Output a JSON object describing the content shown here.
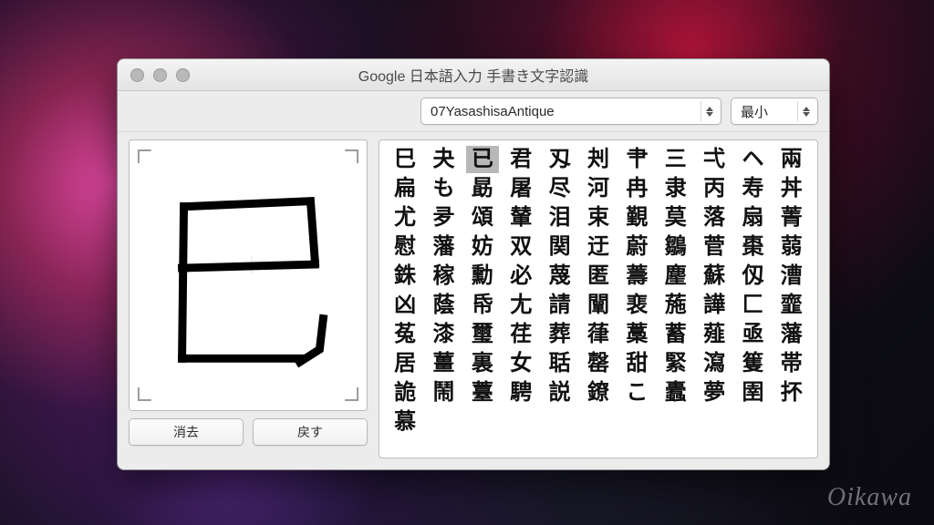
{
  "window": {
    "title": "Google 日本語入力 手書き文字認識"
  },
  "toolbar": {
    "font_select": "07YasashisaAntique",
    "size_select": "最小"
  },
  "buttons": {
    "clear_label": "消去",
    "undo_label": "戻す"
  },
  "watermark": "Oikawa",
  "selected_index": 2,
  "candidates": [
    "巳",
    "夬",
    "已",
    "君",
    "刄",
    "刔",
    "肀",
    "三",
    "弌",
    "ヘ",
    "兩",
    "扁",
    "も",
    "勗",
    "屠",
    "尽",
    "河",
    "冉",
    "隶",
    "丙",
    "寿",
    "丼",
    "尤",
    "夛",
    "頌",
    "輦",
    "泪",
    "束",
    "覲",
    "莫",
    "落",
    "扇",
    "菁",
    "慰",
    "藩",
    "妨",
    "双",
    "関",
    "迂",
    "蔚",
    "鶵",
    "菅",
    "棗",
    "蒻",
    "銖",
    "稼",
    "勳",
    "必",
    "蔑",
    "匿",
    "薵",
    "麈",
    "蘇",
    "仭",
    "漕",
    "凶",
    "蔭",
    "帋",
    "尢",
    "請",
    "闡",
    "裵",
    "葹",
    "譁",
    "匚",
    "韲",
    "菟",
    "漆",
    "璽",
    "荏",
    "葬",
    "葎",
    "藁",
    "蓄",
    "薤",
    "亟",
    "藩",
    "居",
    "薑",
    "裏",
    "女",
    "聒",
    "罄",
    "甜",
    "緊",
    "瀉",
    "篗",
    "帯",
    "詭",
    "鬧",
    "薹",
    "騁",
    "説",
    "鐐",
    "こ",
    "蠹",
    "夢",
    "圉",
    "抔",
    "慕"
  ]
}
